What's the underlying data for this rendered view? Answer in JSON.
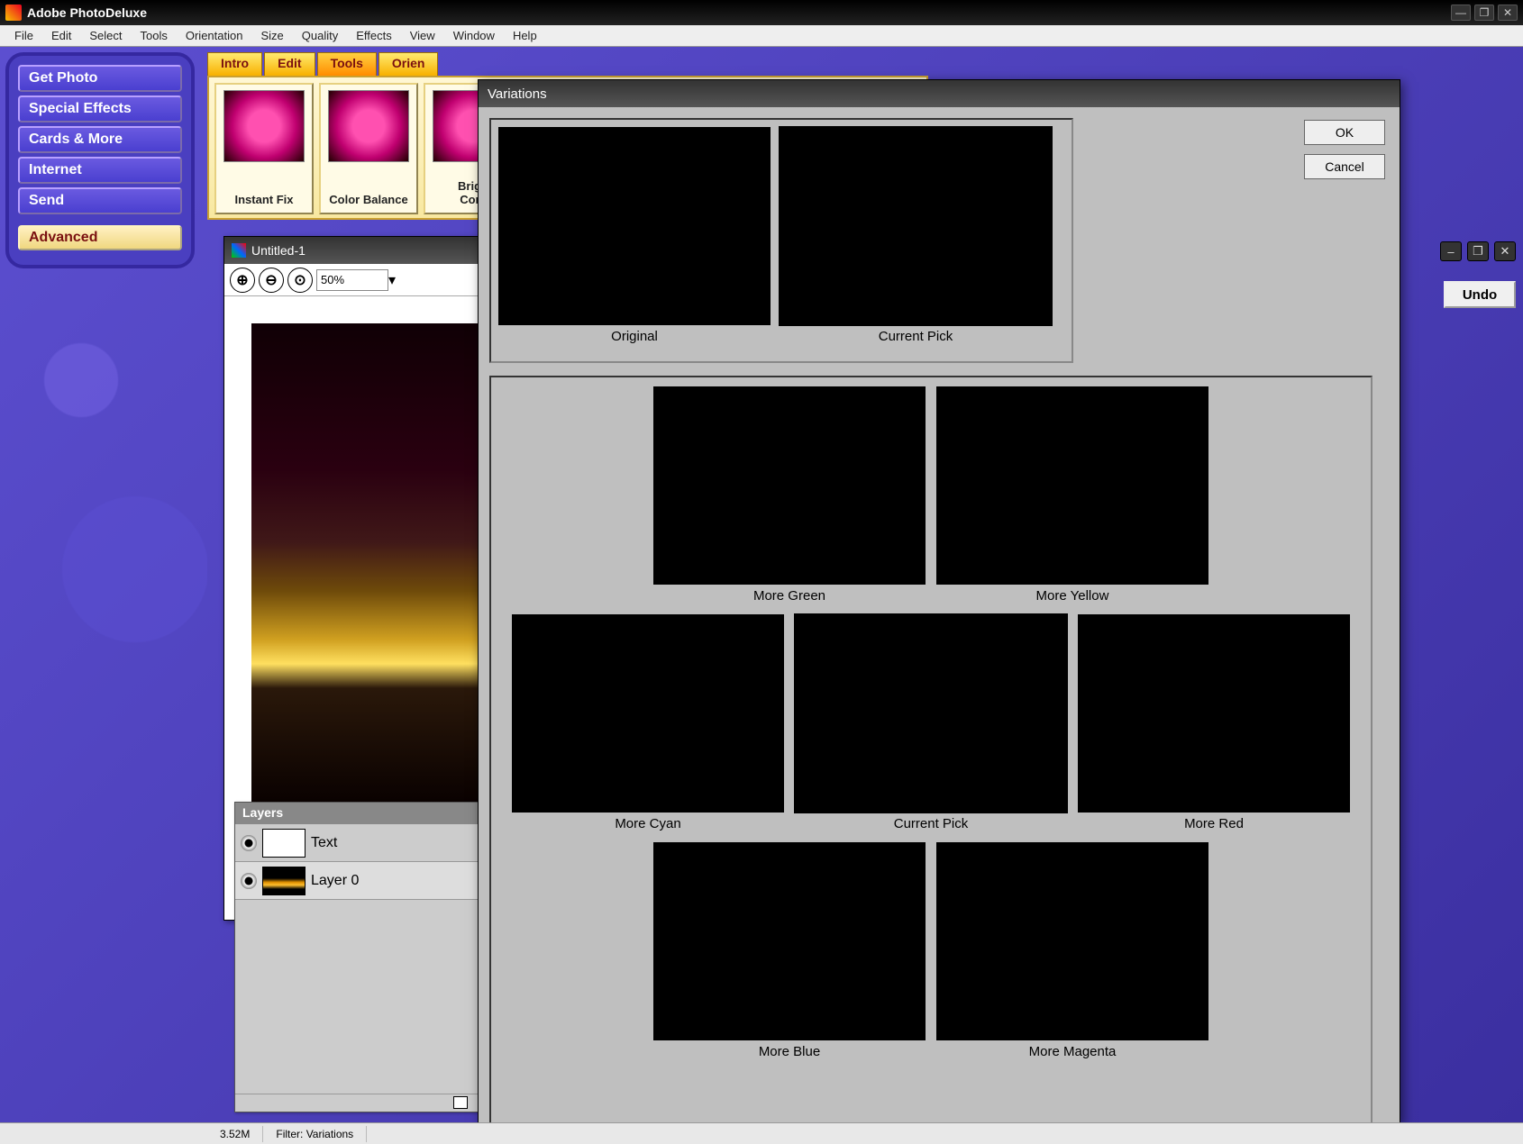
{
  "app_title": "Adobe PhotoDeluxe",
  "menus": [
    "File",
    "Edit",
    "Select",
    "Tools",
    "Orientation",
    "Size",
    "Quality",
    "Effects",
    "View",
    "Window",
    "Help"
  ],
  "sidebar": {
    "buttons": [
      "Get Photo",
      "Special Effects",
      "Cards & More",
      "Internet",
      "Send"
    ],
    "advanced": "Advanced"
  },
  "tool_tabs": [
    "Intro",
    "Edit",
    "Tools",
    "Orien"
  ],
  "tool_buttons": [
    {
      "label": "Instant Fix"
    },
    {
      "label": "Color Balance"
    },
    {
      "label": "Brigh\nCont"
    }
  ],
  "document": {
    "title": "Untitled-1",
    "zoom_value": "50%"
  },
  "undo_label": "Undo",
  "layers_panel": {
    "title": "Layers",
    "rows": [
      {
        "name": "Text",
        "thumb": "blank"
      },
      {
        "name": "Layer 0",
        "thumb": "photo"
      }
    ]
  },
  "statusbar": {
    "filesize": "3.52M",
    "filter": "Filter: Variations"
  },
  "dialog": {
    "title": "Variations",
    "ok": "OK",
    "cancel": "Cancel",
    "top": [
      {
        "label": "Original",
        "current": false
      },
      {
        "label": "Current Pick",
        "current": true
      }
    ],
    "grid": [
      [
        {
          "label": "More Green",
          "tint": "green",
          "current": false
        },
        {
          "label": "More Yellow",
          "tint": "yellow",
          "current": false
        }
      ],
      [
        {
          "label": "More Cyan",
          "tint": "cyan",
          "current": false
        },
        {
          "label": "Current Pick",
          "tint": "none",
          "current": true
        },
        {
          "label": "More Red",
          "tint": "red",
          "current": false
        }
      ],
      [
        {
          "label": "More Blue",
          "tint": "blue",
          "current": false
        },
        {
          "label": "More Magenta",
          "tint": "magenta",
          "current": false
        }
      ]
    ]
  }
}
